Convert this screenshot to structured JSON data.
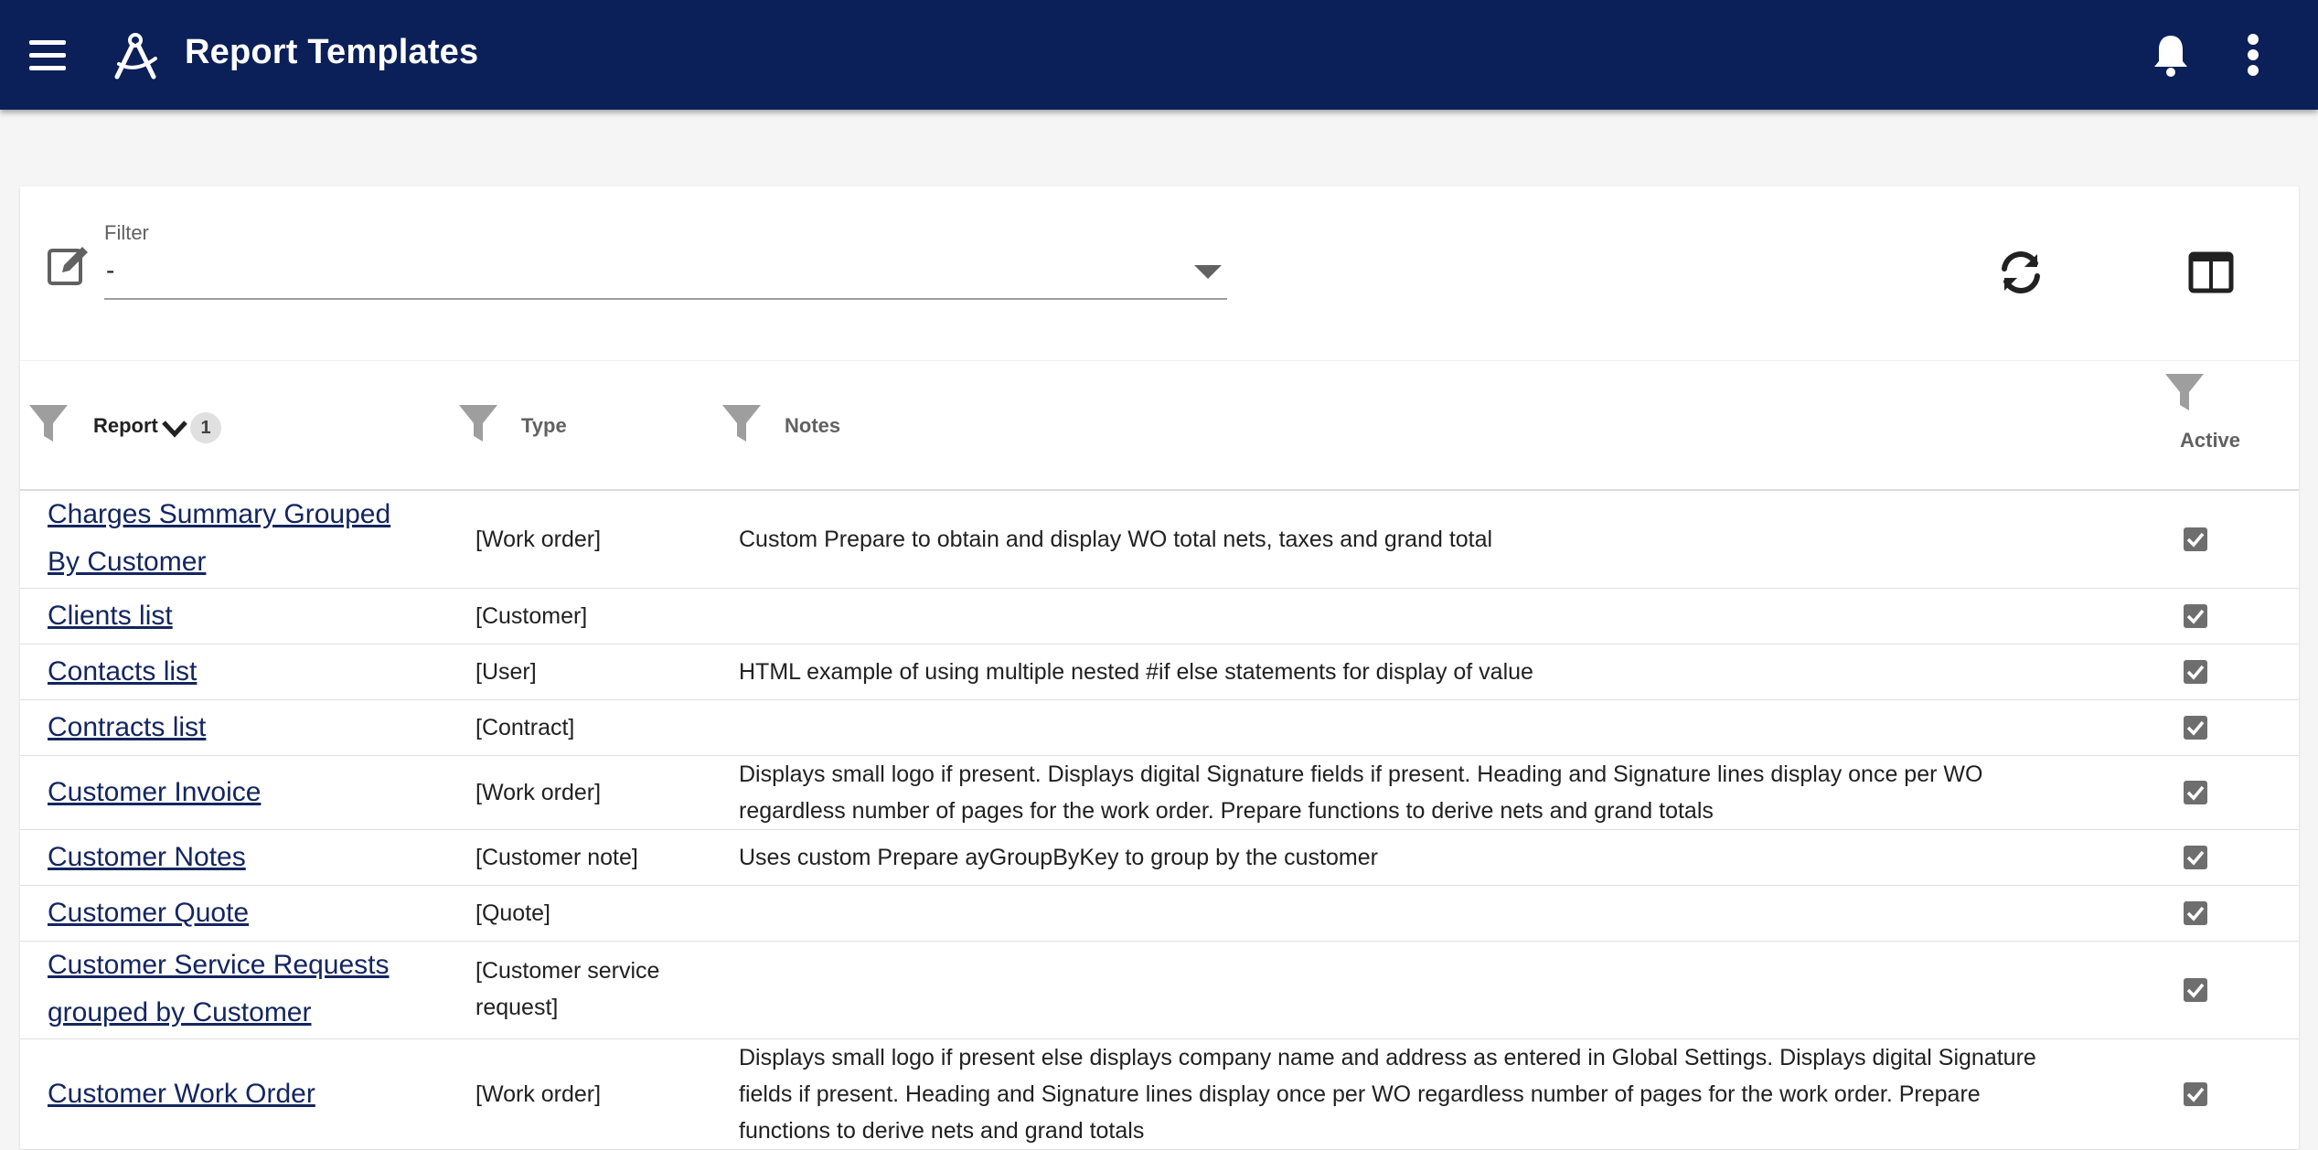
{
  "app": {
    "title": "Report Templates",
    "icons": {
      "menu": "menu-icon",
      "logo": "compass-logo-icon",
      "notifications": "bell-icon",
      "more": "more-vert-icon"
    },
    "colors": {
      "appbar": "#0b2058",
      "link": "#142660",
      "checkbox": "#6e6e6e"
    }
  },
  "filter": {
    "label": "Filter",
    "value": "-",
    "icons": {
      "edit": "edit-note-icon",
      "refresh": "refresh-icon",
      "columns": "view-columns-icon"
    }
  },
  "table": {
    "columns": {
      "report": "Report",
      "report_sort_order": "1",
      "type": "Type",
      "notes": "Notes",
      "active": "Active"
    },
    "rows": [
      {
        "report_line1": "Charges Summary Grouped",
        "report_line2": "By Customer",
        "type": "[Work order]",
        "notes": "Custom Prepare to obtain and display WO total nets, taxes and grand total",
        "active": true
      },
      {
        "report": "Clients list",
        "type": "[Customer]",
        "notes": "",
        "active": true
      },
      {
        "report": "Contacts list",
        "type": "[User]",
        "notes": "HTML example of using multiple nested #if else statements for display of value",
        "active": true
      },
      {
        "report": "Contracts list",
        "type": "[Contract]",
        "notes": "",
        "active": true
      },
      {
        "report": "Customer Invoice",
        "type": "[Work order]",
        "notes_line1": "Displays small logo if present. Displays digital Signature fields if present. Heading and Signature lines display once per WO",
        "notes_line2": "regardless number of pages for the work order. Prepare functions to derive nets and grand totals",
        "active": true
      },
      {
        "report": "Customer Notes",
        "type": "[Customer note]",
        "notes": "Uses custom Prepare ayGroupByKey to group by the customer",
        "active": true
      },
      {
        "report": "Customer Quote",
        "type": "[Quote]",
        "notes": "",
        "active": true
      },
      {
        "report_line1": "Customer Service Requests",
        "report_line2": "grouped by Customer",
        "type_line1": "[Customer service",
        "type_line2": "request]",
        "notes": "",
        "active": true
      },
      {
        "report": "Customer Work Order",
        "type": "[Work order]",
        "notes_line1": "Displays small logo if present else displays company name and address as entered in Global Settings. Displays digital Signature",
        "notes_line2": "fields if present. Heading and Signature lines display once per WO regardless number of pages for the work order. Prepare",
        "notes_line3": "functions to derive nets and grand totals",
        "active": true
      }
    ]
  }
}
